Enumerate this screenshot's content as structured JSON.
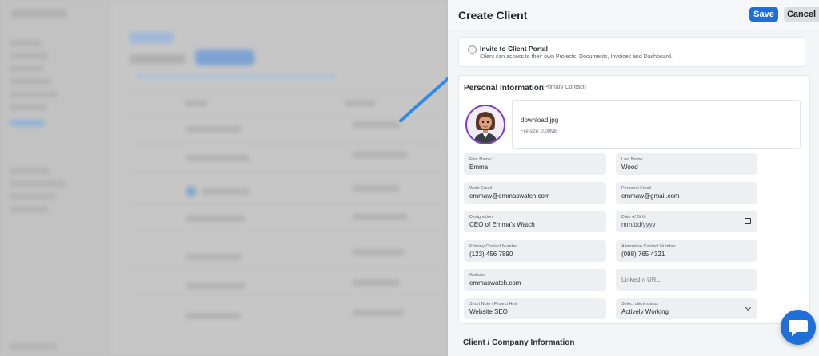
{
  "drawer": {
    "title": "Create Client",
    "save_label": "Save",
    "cancel_label": "Cancel"
  },
  "invite": {
    "label": "Invite to Client Portal",
    "description": "Client can access to their own Projects, Documents, Invoices and Dashboard."
  },
  "personal": {
    "title": "Personal Information",
    "subtitle": "(Primary Contact)",
    "upload": {
      "file_name": "download.jpg",
      "file_size": "File size: 0.00MB"
    },
    "fields": {
      "first_name": {
        "label": "First Name *",
        "value": "Emma"
      },
      "last_name": {
        "label": "Last Name",
        "value": "Wood"
      },
      "work_email": {
        "label": "Work Email",
        "value": "emmaw@emmaswatch.com"
      },
      "personal_email": {
        "label": "Personal Email",
        "value": "emmaw@gmail.com"
      },
      "designation": {
        "label": "Designation",
        "value": "CEO of Emma's Watch"
      },
      "date_of_birth": {
        "label": "Date of Birth",
        "placeholder": "mm/dd/yyyy"
      },
      "primary_contact": {
        "label": "Primary Contact Number",
        "value": "(123) 456 7890"
      },
      "alt_contact": {
        "label": "Alternative Contact Number",
        "value": "(098) 765 4321"
      },
      "website": {
        "label": "Website",
        "value": "emmaswatch.com"
      },
      "linkedin": {
        "placeholder": "Linkedin URL"
      },
      "short_note": {
        "label": "Short Note / Project Hint",
        "value": "Website SEO"
      },
      "client_status": {
        "label": "Select client status",
        "value": "Actively Working"
      }
    }
  },
  "company": {
    "title": "Client / Company Information"
  },
  "colors": {
    "primary": "#1f6fd8",
    "avatar_ring": "#7b3fc7"
  }
}
